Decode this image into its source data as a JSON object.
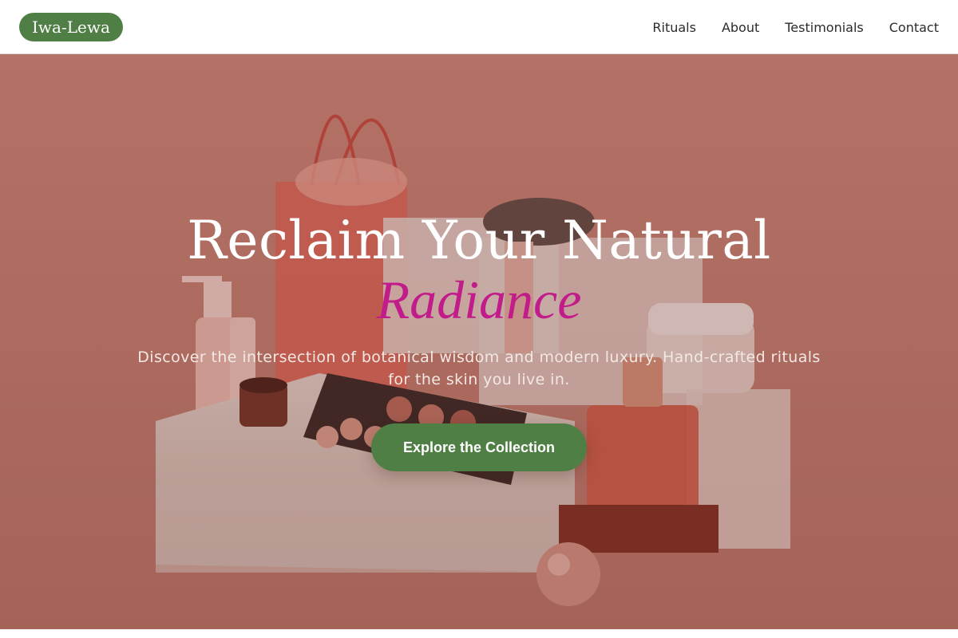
{
  "brand": {
    "name": "Iwa-Lewa",
    "accent": "#4f7f45"
  },
  "nav": {
    "items": [
      {
        "label": "Rituals"
      },
      {
        "label": "About"
      },
      {
        "label": "Testimonials"
      },
      {
        "label": "Contact"
      }
    ]
  },
  "hero": {
    "title_line1": "Reclaim Your Natural",
    "title_line2": "Radiance",
    "subtitle": "Discover the intersection of botanical wisdom and modern luxury. Hand-crafted rituals for the skin you live in.",
    "cta_label": "Explore the Collection",
    "highlight_color": "#c21c8b",
    "background_color": "#c17a70"
  }
}
